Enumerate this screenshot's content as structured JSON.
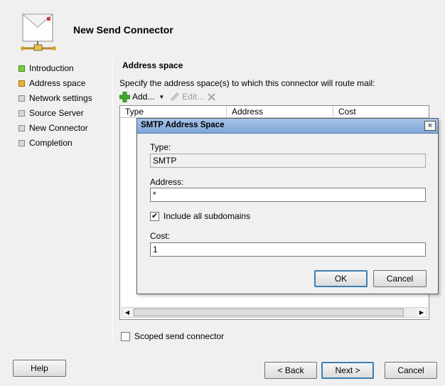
{
  "wizard": {
    "title": "New Send Connector",
    "icon": "mail-connector-icon"
  },
  "steps": [
    {
      "label": "Introduction",
      "state": "done"
    },
    {
      "label": "Address space",
      "state": "current"
    },
    {
      "label": "Network settings",
      "state": "pending"
    },
    {
      "label": "Source Server",
      "state": "pending"
    },
    {
      "label": "New Connector",
      "state": "pending"
    },
    {
      "label": "Completion",
      "state": "pending"
    }
  ],
  "content": {
    "title": "Address space",
    "description": "Specify the address space(s) to which this connector will route mail:",
    "toolbar": {
      "add_label": "Add...",
      "edit_label": "Edit...",
      "remove_icon": "remove-icon"
    },
    "grid": {
      "columns": [
        "Type",
        "Address",
        "Cost"
      ]
    },
    "scoped_label": "Scoped send connector",
    "scoped_checked": false
  },
  "buttons": {
    "help": "Help",
    "back": "< Back",
    "next": "Next >",
    "cancel": "Cancel"
  },
  "dialog": {
    "title": "SMTP Address Space",
    "close_label": "×",
    "type_label": "Type:",
    "type_value": "SMTP",
    "address_label": "Address:",
    "address_value": "*",
    "include_subdomains_label": "Include all subdomains",
    "include_subdomains_checked": true,
    "cost_label": "Cost:",
    "cost_value": "1",
    "ok": "OK",
    "cancel": "Cancel"
  },
  "colors": {
    "step_done": "#7ccd3a",
    "step_current": "#e8b42a",
    "dialog_title_bar": "#8fb2de"
  }
}
